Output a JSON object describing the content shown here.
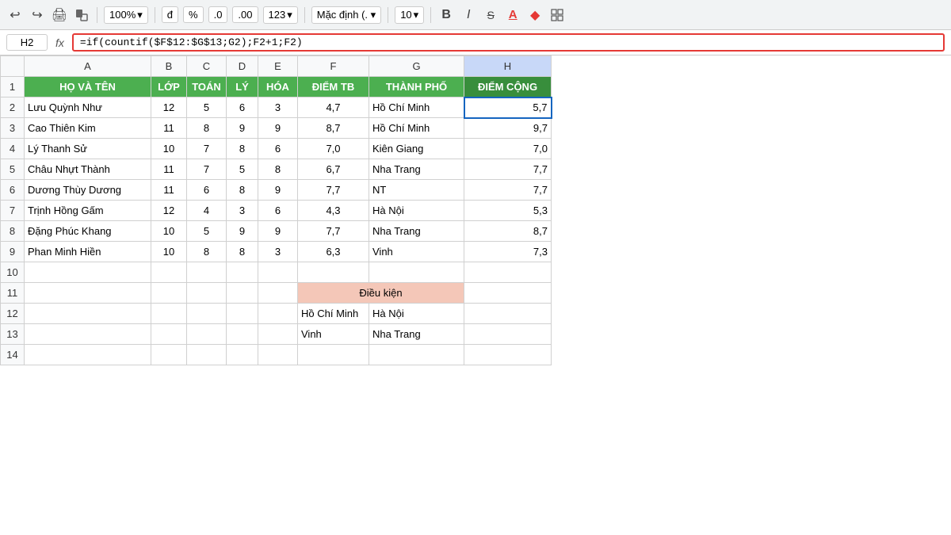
{
  "toolbar": {
    "zoom": "100%",
    "zoom_arrow": "▾",
    "format_d": "đ",
    "format_pct": "%",
    "format_dec0": ".0",
    "format_dec00": ".00",
    "format_num": "123",
    "format_num_arrow": "▾",
    "font_family": "Mặc định (.",
    "font_family_arrow": "▾",
    "font_size": "10",
    "font_size_arrow": "▾",
    "bold": "B",
    "italic": "I",
    "strikethrough": "S",
    "underline": "A",
    "fill_icon": "◆",
    "table_icon": "⊞"
  },
  "formula_bar": {
    "cell_ref": "H2",
    "fx": "fx",
    "formula": "=if(countif($F$12:$G$13;G2);F2+1;F2)"
  },
  "columns": {
    "row_header": "",
    "headers": [
      "A",
      "B",
      "C",
      "D",
      "E",
      "F",
      "G",
      "H"
    ]
  },
  "header_row": {
    "row_num": "1",
    "cells": [
      "HỌ VÀ TÊN",
      "LỚP",
      "TOÁN",
      "LÝ",
      "HÓA",
      "ĐIỂM TB",
      "THÀNH PHỐ",
      "ĐIỂM CỘNG"
    ]
  },
  "data_rows": [
    {
      "row": "2",
      "ho_ten": "Lưu Quỳnh Như",
      "lop": "12",
      "toan": "5",
      "ly": "6",
      "hoa": "3",
      "diem_tb": "4,7",
      "thanh_pho": "Hồ Chí Minh",
      "diem_cong": "5,7"
    },
    {
      "row": "3",
      "ho_ten": "Cao Thiên Kim",
      "lop": "11",
      "toan": "8",
      "ly": "9",
      "hoa": "9",
      "diem_tb": "8,7",
      "thanh_pho": "Hồ Chí Minh",
      "diem_cong": "9,7"
    },
    {
      "row": "4",
      "ho_ten": "Lý Thanh Sử",
      "lop": "10",
      "toan": "7",
      "ly": "8",
      "hoa": "6",
      "diem_tb": "7,0",
      "thanh_pho": "Kiên Giang",
      "diem_cong": "7,0"
    },
    {
      "row": "5",
      "ho_ten": "Châu Nhựt Thành",
      "lop": "11",
      "toan": "7",
      "ly": "5",
      "hoa": "8",
      "diem_tb": "6,7",
      "thanh_pho": "Nha Trang",
      "diem_cong": "7,7"
    },
    {
      "row": "6",
      "ho_ten": "Dương Thùy Dương",
      "lop": "11",
      "toan": "6",
      "ly": "8",
      "hoa": "9",
      "diem_tb": "7,7",
      "thanh_pho": "NT",
      "diem_cong": "7,7"
    },
    {
      "row": "7",
      "ho_ten": "Trịnh Hồng Gấm",
      "lop": "12",
      "toan": "4",
      "ly": "3",
      "hoa": "6",
      "diem_tb": "4,3",
      "thanh_pho": "Hà Nội",
      "diem_cong": "5,3"
    },
    {
      "row": "8",
      "ho_ten": "Đặng Phúc Khang",
      "lop": "10",
      "toan": "5",
      "ly": "9",
      "hoa": "9",
      "diem_tb": "7,7",
      "thanh_pho": "Nha Trang",
      "diem_cong": "8,7"
    },
    {
      "row": "9",
      "ho_ten": "Phan Minh Hiền",
      "lop": "10",
      "toan": "8",
      "ly": "8",
      "hoa": "3",
      "diem_tb": "6,3",
      "thanh_pho": "Vinh",
      "diem_cong": "7,3"
    }
  ],
  "empty_rows": [
    "10",
    "11",
    "12",
    "13",
    "14"
  ],
  "condition_table": {
    "header": "Điều kiện",
    "row1": [
      "Hồ Chí Minh",
      "Hà Nội"
    ],
    "row2": [
      "Vinh",
      "Nha Trang"
    ]
  },
  "active_cell": "H2",
  "diem_cong_label": "DIEM CONG"
}
